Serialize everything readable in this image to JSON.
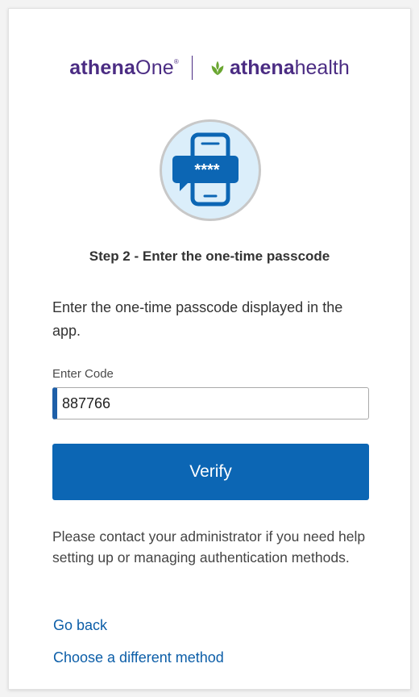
{
  "header": {
    "brand_one_bold": "athena",
    "brand_one_regular": "One",
    "brand_one_mark": "®",
    "brand_health_bold": "athena",
    "brand_health_regular": "health"
  },
  "hero": {
    "icon": "phone-passcode-icon",
    "masked_code": "****"
  },
  "step": {
    "title": "Step 2 - Enter the one-time passcode",
    "instructions": "Enter the one-time passcode displayed in the app."
  },
  "form": {
    "code_label": "Enter Code",
    "code_value": "887766",
    "verify_label": "Verify"
  },
  "help": {
    "text": "Please contact your administrator if you need help setting up or managing authentication methods."
  },
  "links": {
    "go_back": "Go back",
    "choose_method": "Choose a different method"
  },
  "colors": {
    "brand_purple": "#4b2c83",
    "brand_green": "#6aa631",
    "primary_blue": "#0c66b4",
    "link_blue": "#0c5ea8",
    "hero_bg": "#dbeefa"
  }
}
